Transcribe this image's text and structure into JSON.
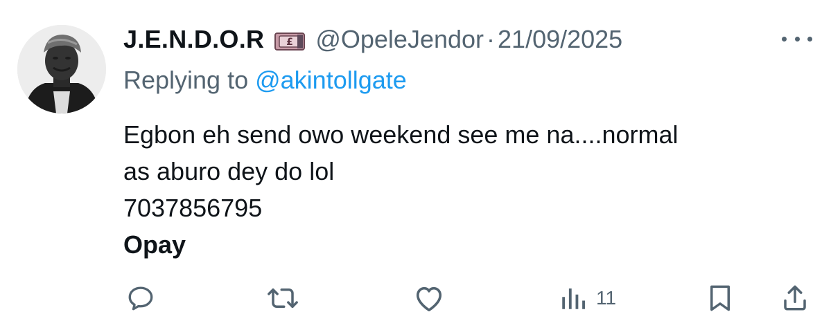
{
  "tweet": {
    "author": {
      "display_name": "J.E.N.D.O.R",
      "name_emoji": "money-with-wings-pound-emoji",
      "handle": "@OpeleJendor",
      "separator": "·",
      "date": "21/09/2025"
    },
    "reply": {
      "prefix": "Replying to ",
      "handle": "@akintollgate"
    },
    "body": {
      "line1": "Egbon eh send owo weekend see me na....normal",
      "line2": "as aburo dey do lol",
      "line3": "7037856795",
      "line4": "Opay"
    },
    "actions": {
      "reply_icon": "comment-icon",
      "retweet_icon": "retweet-icon",
      "like_icon": "heart-icon",
      "views_icon": "analytics-icon",
      "views_count": "11",
      "bookmark_icon": "bookmark-icon",
      "share_icon": "share-icon"
    }
  },
  "colors": {
    "text_primary": "#0f1419",
    "text_secondary": "#536471",
    "link": "#1d9bf0"
  }
}
